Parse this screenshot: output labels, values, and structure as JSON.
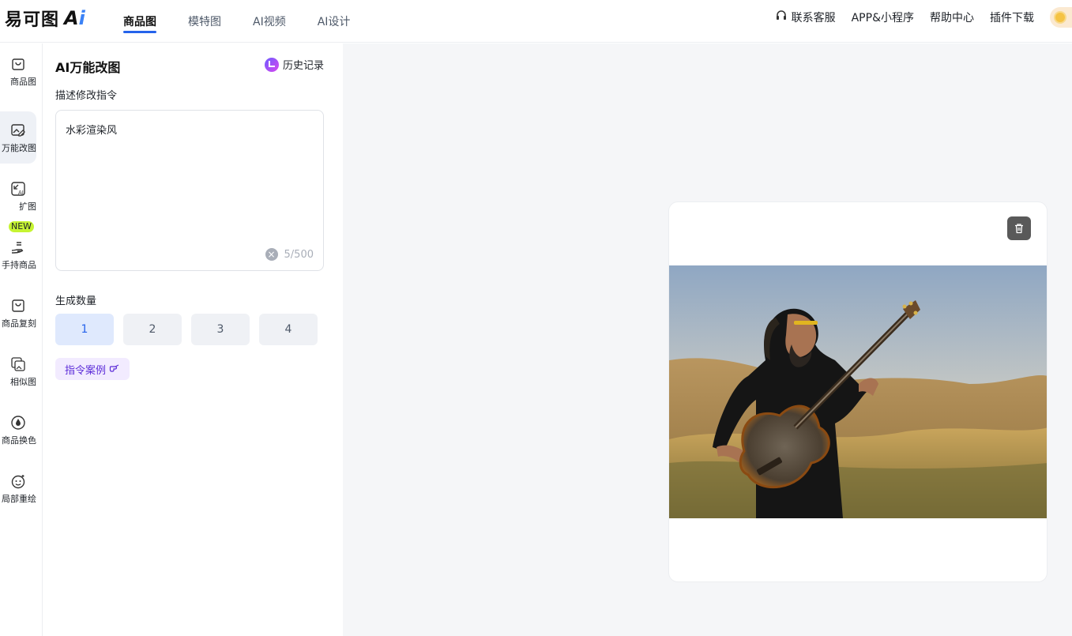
{
  "brand": {
    "name": "易可图",
    "ai_mark": "Ai"
  },
  "nav": {
    "items": [
      {
        "label": "商品图",
        "active": true
      },
      {
        "label": "模特图",
        "active": false
      },
      {
        "label": "AI视频",
        "active": false
      },
      {
        "label": "AI设计",
        "active": false
      }
    ]
  },
  "header_links": {
    "support": "联系客服",
    "app": "APP&小程序",
    "help": "帮助中心",
    "plugin": "插件下载"
  },
  "rail": {
    "items": [
      {
        "label": "商品图",
        "icon": "bag-icon"
      },
      {
        "label": "万能改图",
        "icon": "image-edit-icon",
        "active": true
      },
      {
        "label": "扩图",
        "icon": "expand-ai-icon"
      },
      {
        "label": "手持商品",
        "icon": "hand-product-icon",
        "badge": "NEW"
      },
      {
        "label": "商品复刻",
        "icon": "bag-copy-icon"
      },
      {
        "label": "相似图",
        "icon": "similar-images-icon"
      },
      {
        "label": "商品换色",
        "icon": "color-drop-icon"
      },
      {
        "label": "局部重绘",
        "icon": "repaint-face-icon"
      }
    ]
  },
  "panel": {
    "title": "AI万能改图",
    "history_label": "历史记录",
    "prompt_label": "描述修改指令",
    "prompt_value": "水彩渲染风",
    "char_count": "5/500",
    "quantity_label": "生成数量",
    "quantity_options": [
      "1",
      "2",
      "3",
      "4"
    ],
    "quantity_selected": "1",
    "examples_label": "指令案例"
  },
  "colors": {
    "accent": "#2563eb",
    "selected_bg": "#dfe9fd",
    "examples_text": "#5b2bd8",
    "new_badge": "#c6f432"
  }
}
